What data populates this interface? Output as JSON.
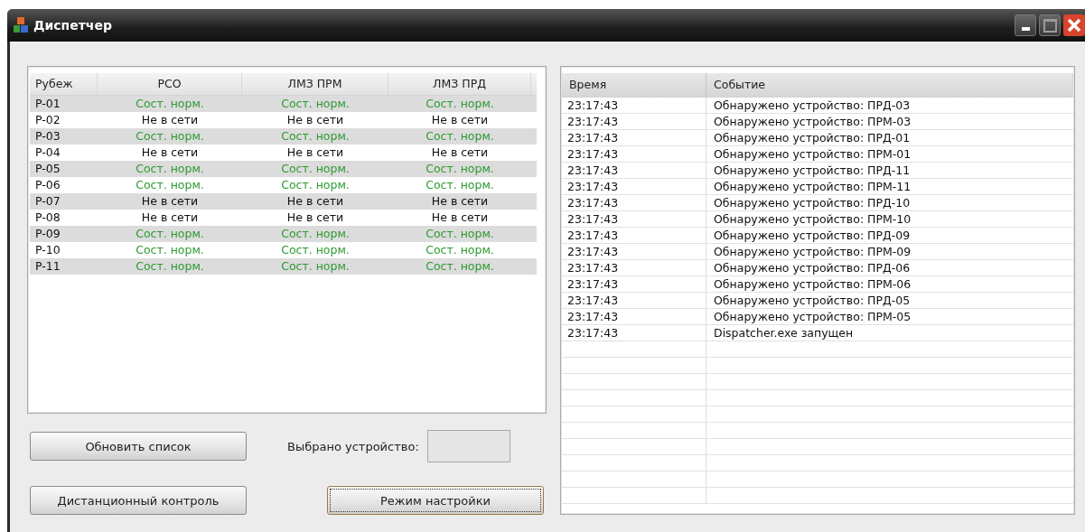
{
  "window": {
    "title": "Диспетчер"
  },
  "devices": {
    "columns": [
      "Рубеж",
      "РСО",
      "ЛМЗ ПРМ",
      "ЛМЗ ПРД"
    ],
    "rows": [
      {
        "cells": [
          {
            "text": "P-01",
            "kind": "plain"
          },
          {
            "text": "Сост. норм.",
            "kind": "ok"
          },
          {
            "text": "Сост. норм.",
            "kind": "ok"
          },
          {
            "text": "Сост. норм.",
            "kind": "ok"
          }
        ]
      },
      {
        "cells": [
          {
            "text": "P-02",
            "kind": "plain"
          },
          {
            "text": "Не в сети",
            "kind": "offline"
          },
          {
            "text": "Не в сети",
            "kind": "offline"
          },
          {
            "text": "Не в сети",
            "kind": "offline"
          }
        ]
      },
      {
        "cells": [
          {
            "text": "P-03",
            "kind": "plain"
          },
          {
            "text": "Сост. норм.",
            "kind": "ok"
          },
          {
            "text": "Сост. норм.",
            "kind": "ok"
          },
          {
            "text": "Сост. норм.",
            "kind": "ok"
          }
        ]
      },
      {
        "cells": [
          {
            "text": "P-04",
            "kind": "plain"
          },
          {
            "text": "Не в сети",
            "kind": "offline"
          },
          {
            "text": "Не в сети",
            "kind": "offline"
          },
          {
            "text": "Не в сети",
            "kind": "offline"
          }
        ]
      },
      {
        "cells": [
          {
            "text": "P-05",
            "kind": "plain"
          },
          {
            "text": "Сост. норм.",
            "kind": "ok"
          },
          {
            "text": "Сост. норм.",
            "kind": "ok"
          },
          {
            "text": "Сост. норм.",
            "kind": "ok"
          }
        ]
      },
      {
        "cells": [
          {
            "text": "P-06",
            "kind": "plain"
          },
          {
            "text": "Сост. норм.",
            "kind": "ok"
          },
          {
            "text": "Сост. норм.",
            "kind": "ok"
          },
          {
            "text": "Сост. норм.",
            "kind": "ok"
          }
        ]
      },
      {
        "cells": [
          {
            "text": "P-07",
            "kind": "plain"
          },
          {
            "text": "Не в сети",
            "kind": "offline"
          },
          {
            "text": "Не в сети",
            "kind": "offline"
          },
          {
            "text": "Не в сети",
            "kind": "offline"
          }
        ]
      },
      {
        "cells": [
          {
            "text": "P-08",
            "kind": "plain"
          },
          {
            "text": "Не в сети",
            "kind": "offline"
          },
          {
            "text": "Не в сети",
            "kind": "offline"
          },
          {
            "text": "Не в сети",
            "kind": "offline"
          }
        ]
      },
      {
        "cells": [
          {
            "text": "P-09",
            "kind": "plain"
          },
          {
            "text": "Сост. норм.",
            "kind": "ok"
          },
          {
            "text": "Сост. норм.",
            "kind": "ok"
          },
          {
            "text": "Сост. норм.",
            "kind": "ok"
          }
        ]
      },
      {
        "cells": [
          {
            "text": "P-10",
            "kind": "plain"
          },
          {
            "text": "Сост. норм.",
            "kind": "ok"
          },
          {
            "text": "Сост. норм.",
            "kind": "ok"
          },
          {
            "text": "Сост. норм.",
            "kind": "ok"
          }
        ]
      },
      {
        "cells": [
          {
            "text": "P-11",
            "kind": "plain"
          },
          {
            "text": "Сост. норм.",
            "kind": "ok"
          },
          {
            "text": "Сост. норм.",
            "kind": "ok"
          },
          {
            "text": "Сост. норм.",
            "kind": "ok"
          }
        ]
      }
    ]
  },
  "buttons": [
    {
      "label": "Обновить список",
      "focused": false
    },
    {
      "label": "Дистанционный контроль",
      "focused": false
    },
    {
      "label": "Режим настройки",
      "focused": true
    }
  ],
  "selected_device": {
    "label": "Выбрано устройство:"
  },
  "log": {
    "columns": [
      "Время",
      "Событие"
    ],
    "rows": [
      {
        "time": "23:17:43",
        "event": "Обнаружено устройство: ПРД-03"
      },
      {
        "time": "23:17:43",
        "event": "Обнаружено устройство: ПРМ-03"
      },
      {
        "time": "23:17:43",
        "event": "Обнаружено устройство: ПРД-01"
      },
      {
        "time": "23:17:43",
        "event": "Обнаружено устройство: ПРМ-01"
      },
      {
        "time": "23:17:43",
        "event": "Обнаружено устройство: ПРД-11"
      },
      {
        "time": "23:17:43",
        "event": "Обнаружено устройство: ПРМ-11"
      },
      {
        "time": "23:17:43",
        "event": "Обнаружено устройство: ПРД-10"
      },
      {
        "time": "23:17:43",
        "event": "Обнаружено устройство: ПРМ-10"
      },
      {
        "time": "23:17:43",
        "event": "Обнаружено устройство: ПРД-09"
      },
      {
        "time": "23:17:43",
        "event": "Обнаружено устройство: ПРМ-09"
      },
      {
        "time": "23:17:43",
        "event": "Обнаружено устройство: ПРД-06"
      },
      {
        "time": "23:17:43",
        "event": "Обнаружено устройство: ПРМ-06"
      },
      {
        "time": "23:17:43",
        "event": "Обнаружено устройство: ПРД-05"
      },
      {
        "time": "23:17:43",
        "event": "Обнаружено устройство: ПРМ-05"
      },
      {
        "time": "23:17:43",
        "event": "Dispatcher.exe запущен"
      }
    ]
  }
}
